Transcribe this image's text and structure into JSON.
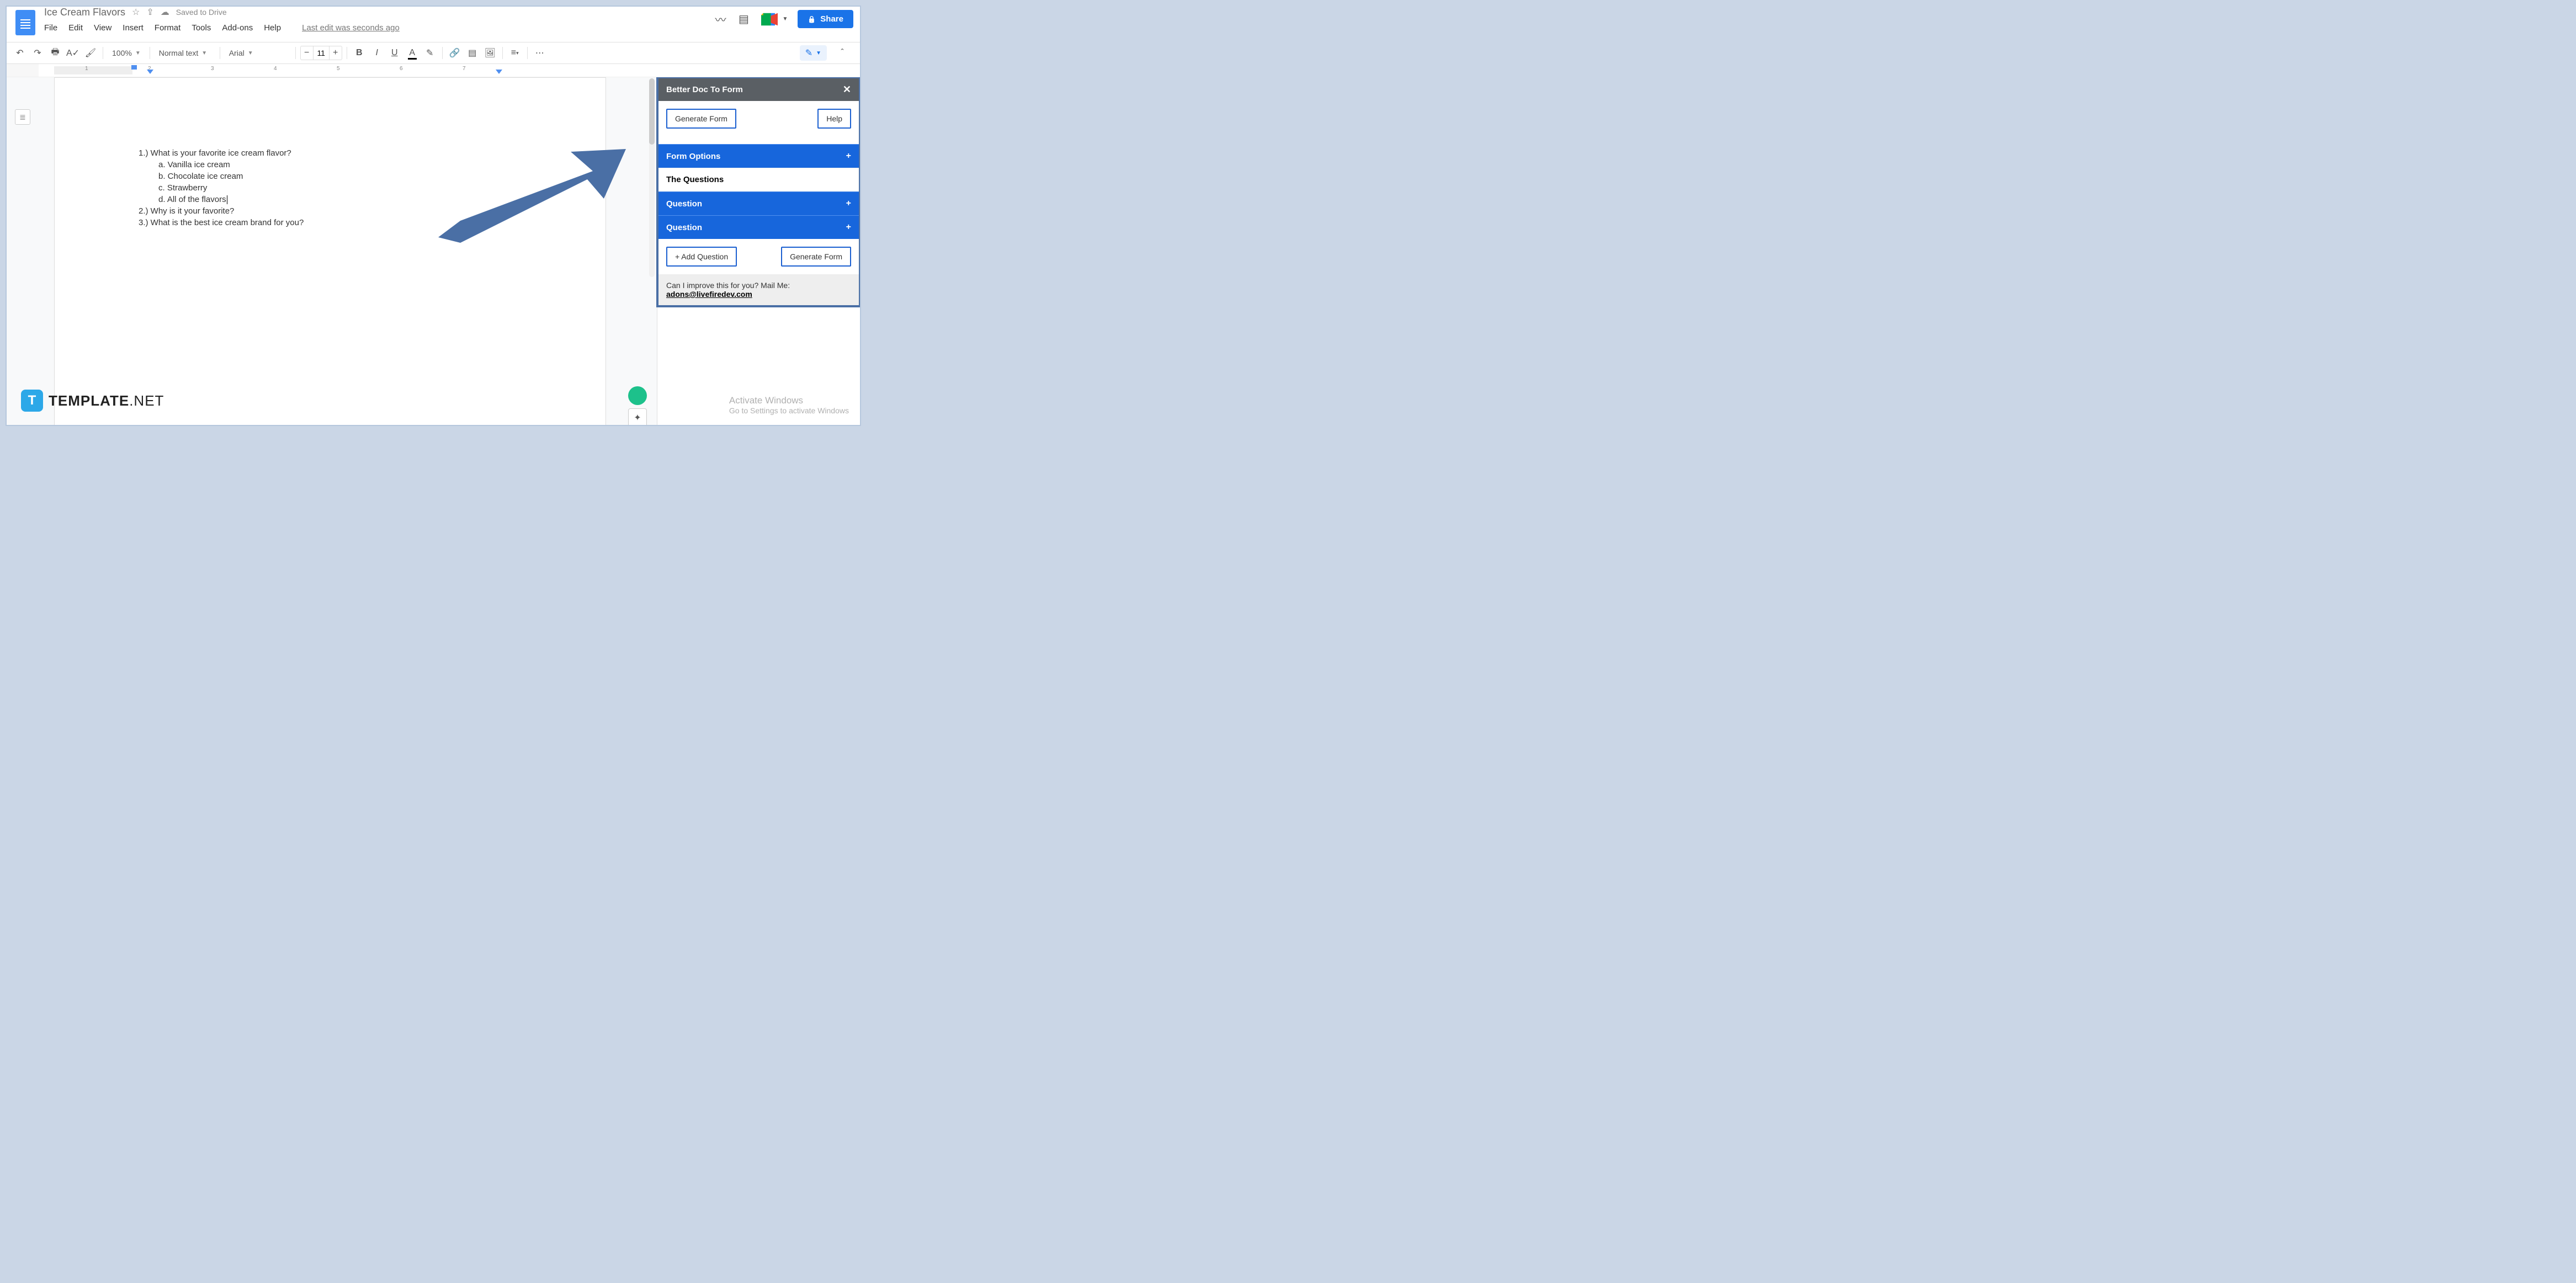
{
  "header": {
    "doc_title": "Ice Cream Flavors",
    "saved_text": "Saved to Drive",
    "last_edit": "Last edit was seconds ago",
    "menus": [
      "File",
      "Edit",
      "View",
      "Insert",
      "Format",
      "Tools",
      "Add-ons",
      "Help"
    ],
    "share_label": "Share"
  },
  "toolbar": {
    "zoom": "100%",
    "style": "Normal text",
    "font": "Arial",
    "font_size": "11"
  },
  "ruler": {
    "marks": [
      "1",
      "2",
      "3",
      "4",
      "5",
      "6",
      "7"
    ]
  },
  "document": {
    "q1": "1.)  What is your favorite ice cream flavor?",
    "q1_opts": [
      "a.   Vanilla ice cream",
      "b.   Chocolate ice cream",
      "c.   Strawberry",
      "d.   All of the flavors"
    ],
    "q2": "2.)  Why is it your favorite?",
    "q3": "3.)  What is the best ice cream brand for you?"
  },
  "sidebar": {
    "title": "Better Doc To Form",
    "generate_btn": "Generate Form",
    "help_btn": "Help",
    "form_options": "Form Options",
    "the_questions": "The Questions",
    "question_label": "Question",
    "add_question": "+ Add Question",
    "generate_btn2": "Generate Form",
    "footer_text": "Can I improve this for you? Mail Me:",
    "footer_email": "adons@livefiredev.com"
  },
  "watermark": {
    "line1": "Activate Windows",
    "line2": "Go to Settings to activate Windows"
  },
  "brand": {
    "icon": "T",
    "text1": "TEMPLATE",
    "text2": ".NET"
  }
}
